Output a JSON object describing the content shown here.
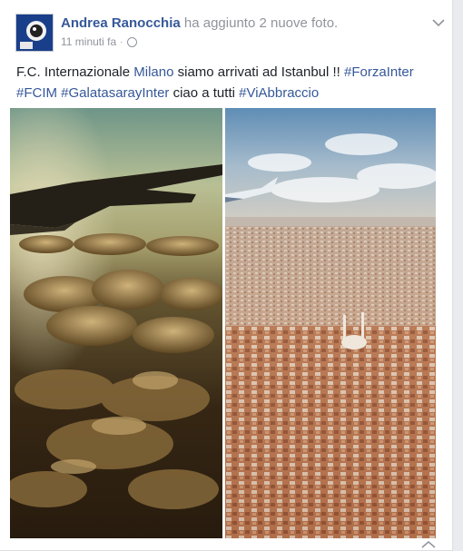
{
  "post": {
    "author": "Andrea Ranocchia",
    "action": "ha aggiunto 2 nuove foto.",
    "time": "11 minuti fa",
    "text_parts": [
      {
        "t": "F.C. Internazionale ",
        "link": false
      },
      {
        "t": "Milano",
        "link": true
      },
      {
        "t": " siamo arrivati ad Istanbul !! ",
        "link": false
      },
      {
        "t": "#ForzaInter",
        "link": true
      },
      {
        "t": " ",
        "link": false
      },
      {
        "t": "#FCIM",
        "link": true
      },
      {
        "t": " ",
        "link": false
      },
      {
        "t": "#GalatasarayInter",
        "link": true
      },
      {
        "t": " ciao a tutti ",
        "link": false
      },
      {
        "t": "#ViAbbraccio",
        "link": true
      }
    ]
  },
  "photos": [
    {
      "name": "photo-airplane-wing-clouds",
      "subject": "airplane wing above clouds at sunset"
    },
    {
      "name": "photo-istanbul-aerial",
      "subject": "aerial view of Istanbul with airplane wingtip"
    }
  ],
  "icons": {
    "avatar": "avatar-icon",
    "globe": "globe-icon",
    "options": "chevron-down-icon"
  },
  "colors": {
    "link": "#365899",
    "meta": "#90949c",
    "text": "#1d2129"
  }
}
